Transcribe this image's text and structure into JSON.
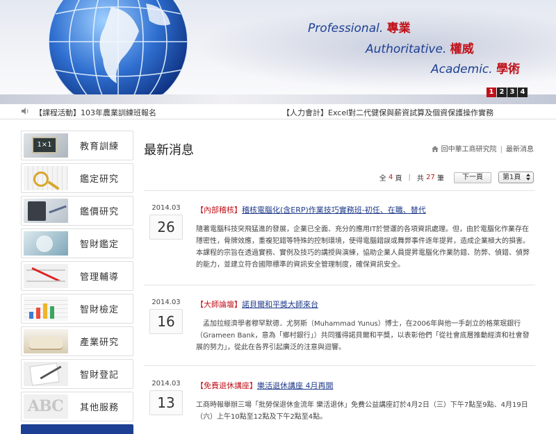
{
  "banner": {
    "slogans": [
      {
        "en": "Professional.",
        "zh": "專業"
      },
      {
        "en": "Authoritative.",
        "zh": "權威"
      },
      {
        "en": "Academic.",
        "zh": "學術"
      }
    ],
    "slides": [
      "1",
      "2",
      "3",
      "4"
    ],
    "active_slide": "1"
  },
  "ticker": {
    "items": [
      "【課程活動】103年農業訓練班報名",
      "【人力會計】Excel對二代健保與薪資試算及個資保護操作實務"
    ]
  },
  "sidebar": {
    "items": [
      {
        "label": "教育訓練",
        "icon": "training-thumb-icon"
      },
      {
        "label": "鑑定研究",
        "icon": "appraisal-thumb-icon"
      },
      {
        "label": "鑑價研究",
        "icon": "valuation-thumb-icon"
      },
      {
        "label": "智財鑑定",
        "icon": "ip-appraisal-thumb-icon"
      },
      {
        "label": "管理輔導",
        "icon": "management-thumb-icon"
      },
      {
        "label": "智財檢定",
        "icon": "ip-certification-thumb-icon"
      },
      {
        "label": "產業研究",
        "icon": "industry-research-thumb-icon"
      },
      {
        "label": "智財登記",
        "icon": "ip-registration-thumb-icon"
      },
      {
        "label": "其他服務",
        "icon": "other-services-thumb-icon"
      }
    ]
  },
  "main": {
    "title": "最新消息",
    "breadcrumb": {
      "home": "回中華工商研究院",
      "current": "最新消息"
    },
    "pager": {
      "total_prefix": "全",
      "total_pages": "4",
      "total_suffix": "頁",
      "count_prefix": "共",
      "count": "27",
      "count_suffix": "筆",
      "next_label": "下一頁",
      "page_select": "第1頁"
    },
    "news": [
      {
        "year_month": "2014.03",
        "day": "26",
        "category": "【內部稽核】",
        "title": "稽核電腦化(含ERP)作業技巧實務班-初任、在職、替代",
        "body": "隨著電腦科技突飛猛進的發展，企業已全面、充分的應用IT於營運的各項資訊處理。但，由於電腦化作業存在隱密性，骨牌效應，重複犯錯等特殊的控制環境，使得電腦錯誤或舞弊事件逐年提昇，造成企業極大的損害。本課程的宗旨在透過實務、實例及技巧的講授與演練，協助企業人員提昇電腦化作業防錯、防弊、偵錯、偵弊的能力，並建立符合國際標準的資訊安全管理制度，確保資訊安全。"
      },
      {
        "year_month": "2014.03",
        "day": "16",
        "category": "【大師論壇】",
        "title": "諾貝爾和平獎大師來台",
        "body": "　孟加拉經濟學者穆罕默德．尤努斯（Muhammad Yunus）博士，在2006年與他一手創立的格萊珉銀行（Grameen Bank，意為「鄉村銀行」）共同獲得諾貝爾和平獎，以表彰他們「從社會底層推動經濟和社會發展的努力」，從此在各界引起廣泛的注意與迴響。"
      },
      {
        "year_month": "2014.03",
        "day": "13",
        "category": "【免費退休講座】",
        "title": "樂活退休講座 4月再開",
        "body": "工商時報舉辦三場「批勞保退休金流年 樂活退休」免費公益講座訂於4月2日（三）下午7點至9點、4月19日（六）上午10點至12點及下午2點至4點。"
      }
    ]
  }
}
